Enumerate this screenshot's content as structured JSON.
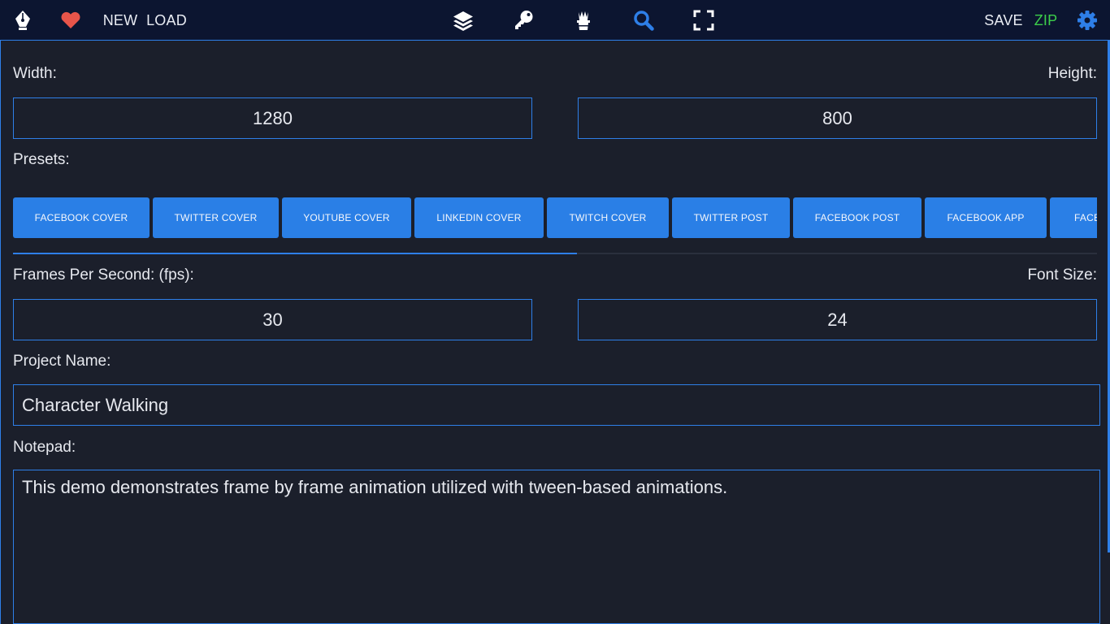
{
  "toolbar": {
    "new_label": "NEW",
    "load_label": "LOAD",
    "save_label": "SAVE",
    "zip_label": "ZIP",
    "icons": [
      "pen-nib-icon",
      "heart-icon",
      "layers-icon",
      "key-icon",
      "magic-hat-icon",
      "search-icon",
      "fullscreen-icon",
      "gear-icon"
    ],
    "colors": {
      "heart": "#e8554a",
      "accent": "#2e7fe8",
      "zip": "#3ccf4a",
      "bar_bg": "#0c1530"
    }
  },
  "form": {
    "width_label": "Width:",
    "width_value": "1280",
    "height_label": "Height:",
    "height_value": "800",
    "presets_label": "Presets:",
    "presets": [
      "FACEBOOK COVER",
      "TWITTER COVER",
      "YOUTUBE COVER",
      "LINKEDIN COVER",
      "TWITCH COVER",
      "TWITTER POST",
      "FACEBOOK POST",
      "FACEBOOK APP",
      "FACE"
    ],
    "fps_label": "Frames Per Second: (fps):",
    "fps_value": "30",
    "font_size_label": "Font Size:",
    "font_size_value": "24",
    "project_name_label": "Project Name:",
    "project_name_value": "Character Walking",
    "notepad_label": "Notepad:",
    "notepad_value": "This demo demonstrates frame by frame animation utilized with tween-based animations."
  }
}
